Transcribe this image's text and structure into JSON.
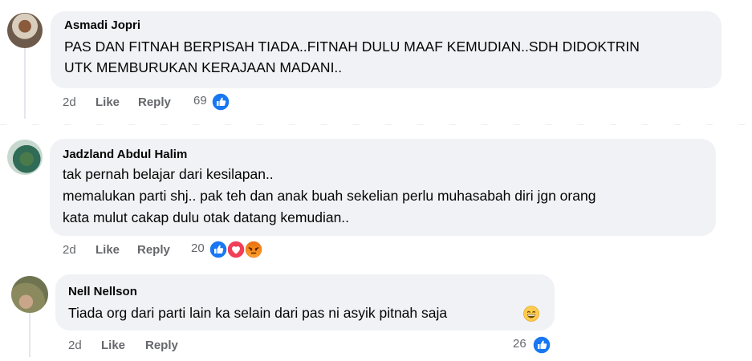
{
  "comments": [
    {
      "author": "Asmadi Jopri",
      "lines": [
        "PAS DAN FITNAH BERPISAH TIADA..FITNAH DULU MAAF KEMUDIAN..SDH DIDOKTRIN",
        "UTK MEMBURUKAN KERAJAAN MADANI.."
      ],
      "time": "2d",
      "like_label": "Like",
      "reply_label": "Reply",
      "reaction_count": "69",
      "reactions": [
        "like-icon"
      ]
    },
    {
      "author": "Jadzland Abdul Halim",
      "lines": [
        "tak pernah belajar dari kesilapan..",
        "memalukan parti shj.. pak teh dan anak buah sekelian perlu muhasabah diri jgn orang",
        "kata mulut cakap dulu otak datang kemudian.."
      ],
      "time": "2d",
      "like_label": "Like",
      "reply_label": "Reply",
      "reaction_count": "20",
      "reactions": [
        "like-icon",
        "love-icon",
        "angry-icon"
      ]
    },
    {
      "author": "Nell Nellson",
      "lines": [
        "Tiada org dari parti lain ka selain dari pas ni asyik pitnah saja"
      ],
      "emoji": "grinning-face-icon",
      "time": "2d",
      "like_label": "Like",
      "reply_label": "Reply",
      "reaction_count": "26",
      "reactions": [
        "like-icon"
      ]
    }
  ],
  "colors": {
    "bubble": "#f0f2f5",
    "secondary_text": "#65676b",
    "like_blue": "#1877f2",
    "love_red": "#f33e58",
    "angry_orange": "#e9710f"
  }
}
